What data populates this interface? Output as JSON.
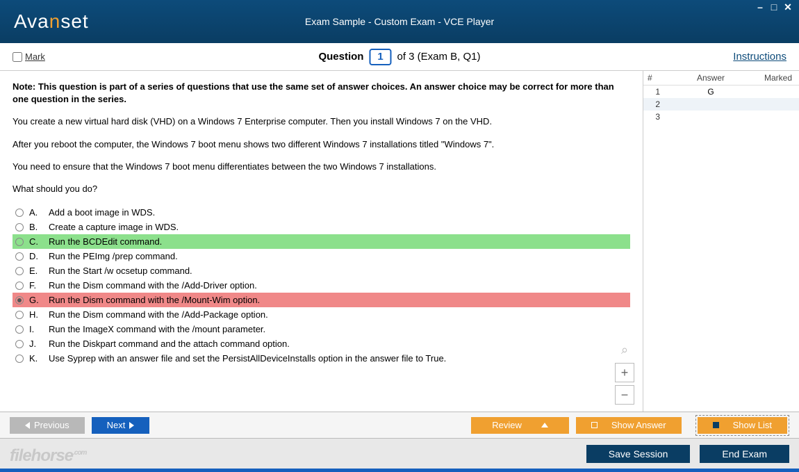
{
  "header": {
    "logo_pre": "Ava",
    "logo_accent": "n",
    "logo_post": "set",
    "title": "Exam Sample - Custom Exam - VCE Player"
  },
  "qbar": {
    "mark_label": "Mark",
    "question_label": "Question",
    "question_num": "1",
    "of_text": "of 3 (Exam B, Q1)",
    "instructions": "Instructions"
  },
  "content": {
    "note": "Note: This question is part of a series of questions that use the same set of answer choices. An answer choice may be correct for more than one question in the series.",
    "p1": "You create a new virtual hard disk (VHD) on a Windows 7 Enterprise computer. Then you install Windows 7 on the VHD.",
    "p2": "After you reboot the computer, the Windows 7 boot menu shows two different Windows 7 installations titled \"Windows 7\".",
    "p3": "You need to ensure that the Windows 7 boot menu differentiates between the two Windows 7 installations.",
    "p4": "What should you do?",
    "answers": [
      {
        "letter": "A.",
        "text": "Add a boot image in WDS.",
        "state": ""
      },
      {
        "letter": "B.",
        "text": "Create a capture image in WDS.",
        "state": ""
      },
      {
        "letter": "C.",
        "text": "Run the BCDEdit command.",
        "state": "correct"
      },
      {
        "letter": "D.",
        "text": "Run the PEImg /prep command.",
        "state": ""
      },
      {
        "letter": "E.",
        "text": "Run the Start /w ocsetup command.",
        "state": ""
      },
      {
        "letter": "F.",
        "text": "Run the Dism command with the /Add-Driver option.",
        "state": ""
      },
      {
        "letter": "G.",
        "text": "Run the Dism command with the /Mount-Wim option.",
        "state": "wrong"
      },
      {
        "letter": "H.",
        "text": "Run the Dism command with the /Add-Package option.",
        "state": ""
      },
      {
        "letter": "I.",
        "text": "Run the ImageX command with the /mount parameter.",
        "state": ""
      },
      {
        "letter": "J.",
        "text": "Run the Diskpart command and the attach command option.",
        "state": ""
      },
      {
        "letter": "K.",
        "text": "Use Syprep with an answer file and set the PersistAllDeviceInstalls option in the answer file to True.",
        "state": ""
      }
    ]
  },
  "sidebar": {
    "h1": "#",
    "h2": "Answer",
    "h3": "Marked",
    "rows": [
      {
        "n": "1",
        "ans": "G"
      },
      {
        "n": "2",
        "ans": ""
      },
      {
        "n": "3",
        "ans": ""
      }
    ]
  },
  "buttons": {
    "previous": "Previous",
    "next": "Next",
    "review": "Review",
    "show_answer": "Show Answer",
    "show_list": "Show List",
    "save_session": "Save Session",
    "end_exam": "End Exam"
  },
  "watermark": "filehorse",
  "watermark_suffix": ".com"
}
